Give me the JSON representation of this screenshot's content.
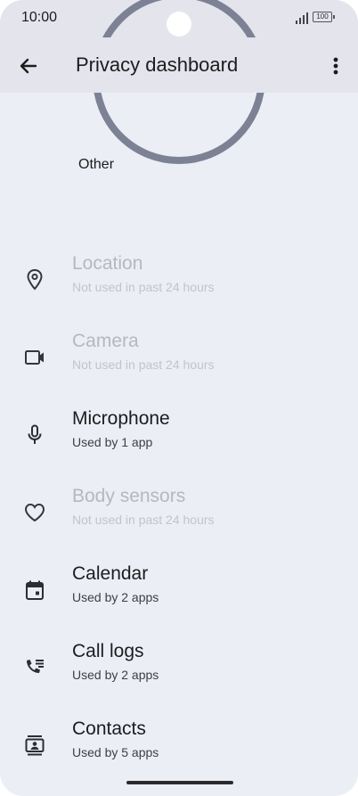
{
  "status": {
    "time": "10:00",
    "battery": "100"
  },
  "appbar": {
    "title": "Privacy dashboard"
  },
  "chart": {
    "label": "Other"
  },
  "permissions": [
    {
      "label": "Location",
      "sub": "Not used in past 24 hours",
      "icon": "location-icon"
    },
    {
      "label": "Camera",
      "sub": "Not used in past 24 hours",
      "icon": "camera-icon"
    },
    {
      "label": "Microphone",
      "sub": "Used by 1 app",
      "icon": "microphone-icon"
    },
    {
      "label": "Body sensors",
      "sub": "Not used in past 24 hours",
      "icon": "heart-icon"
    },
    {
      "label": "Calendar",
      "sub": "Used by 2 apps",
      "icon": "calendar-icon"
    },
    {
      "label": "Call logs",
      "sub": "Used by 2 apps",
      "icon": "call-log-icon"
    },
    {
      "label": "Contacts",
      "sub": "Used by 5 apps",
      "icon": "contacts-icon"
    }
  ],
  "colors": {
    "accent_ring": "#7c8294",
    "disabled_text": "#b6b8c0",
    "background": "#eceef6"
  }
}
